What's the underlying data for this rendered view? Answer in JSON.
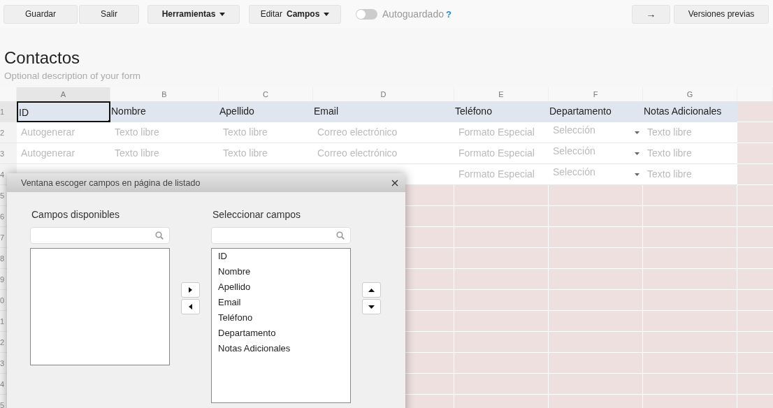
{
  "toolbar": {
    "buttons": [
      {
        "label": "Guardar",
        "kind": "plain"
      },
      {
        "label": "Salir",
        "kind": "plain"
      },
      {
        "label": "Herramientas",
        "kind": "menu"
      },
      {
        "label": "Editar **Campos**",
        "kind": "menu"
      }
    ],
    "autosave": {
      "label": "Autoguardado",
      "on": false,
      "help": "?"
    },
    "right_buttons": [
      {
        "label": "→"
      },
      {
        "label": "Versiones previas"
      }
    ]
  },
  "form": {
    "title": "Contactos",
    "description": "Optional description of your form"
  },
  "grid": {
    "columns": [
      {
        "label": "A",
        "selected": true
      },
      {
        "label": "B",
        "selected": false
      },
      {
        "label": "C",
        "selected": false
      },
      {
        "label": "D",
        "selected": false
      },
      {
        "label": "E",
        "selected": false
      },
      {
        "label": "F",
        "selected": false
      },
      {
        "label": "G",
        "selected": false
      }
    ],
    "rows": [
      {
        "number": "1",
        "selected": true,
        "kind": "header",
        "cells": [
          {
            "text": "ID",
            "kind": "text"
          },
          {
            "text": "Nombre",
            "kind": "text"
          },
          {
            "text": "Apellido",
            "kind": "text"
          },
          {
            "text": "Email",
            "kind": "text"
          },
          {
            "text": "Teléfono",
            "kind": "text"
          },
          {
            "text": "Departamento",
            "kind": "text"
          },
          {
            "text": "Notas Adicionales",
            "kind": "text"
          }
        ]
      },
      {
        "number": "2",
        "selected": false,
        "kind": "field",
        "cells": [
          {
            "text": "Autogenerar",
            "kind": "text"
          },
          {
            "text": "Texto libre",
            "kind": "text"
          },
          {
            "text": "Texto libre",
            "kind": "text"
          },
          {
            "text": "Correo electrónico",
            "kind": "text"
          },
          {
            "text": "Formato Especial",
            "kind": "text"
          },
          {
            "text": "Selección",
            "kind": "select"
          },
          {
            "text": "Texto libre",
            "kind": "text"
          }
        ]
      },
      {
        "number": "3",
        "selected": false,
        "kind": "field",
        "cells": [
          {
            "text": "Autogenerar",
            "kind": "text"
          },
          {
            "text": "Texto libre",
            "kind": "text"
          },
          {
            "text": "Texto libre",
            "kind": "text"
          },
          {
            "text": "Correo electrónico",
            "kind": "text"
          },
          {
            "text": "Formato Especial",
            "kind": "text"
          },
          {
            "text": "Selección",
            "kind": "select"
          },
          {
            "text": "Texto libre",
            "kind": "text"
          }
        ]
      },
      {
        "number": "4",
        "selected": false,
        "kind": "field",
        "cells": [
          {
            "kind": "covered"
          },
          {
            "kind": "covered"
          },
          {
            "kind": "covered"
          },
          {
            "kind": "covered"
          },
          {
            "text": "Formato Especial",
            "kind": "text"
          },
          {
            "text": "Selección",
            "kind": "select"
          },
          {
            "text": "Texto libre",
            "kind": "text"
          }
        ]
      },
      {
        "number": "5",
        "selected": false,
        "kind": "empty"
      },
      {
        "number": "6",
        "selected": false,
        "kind": "empty"
      },
      {
        "number": "7",
        "selected": false,
        "kind": "empty"
      },
      {
        "number": "8",
        "selected": false,
        "kind": "empty"
      },
      {
        "number": "9",
        "selected": false,
        "kind": "empty"
      },
      {
        "number": "0",
        "selected": false,
        "kind": "empty"
      },
      {
        "number": "1",
        "selected": false,
        "kind": "empty"
      },
      {
        "number": "2",
        "selected": false,
        "kind": "empty"
      },
      {
        "number": "3",
        "selected": false,
        "kind": "empty"
      },
      {
        "number": "4",
        "selected": false,
        "kind": "empty"
      },
      {
        "number": "5",
        "selected": false,
        "kind": "empty"
      }
    ]
  },
  "dialog": {
    "title": "Ventana escoger campos en página de listado",
    "available": {
      "label": "Campos disponibles"
    },
    "selected_fields": {
      "label": "Seleccionar campos",
      "items": [
        "ID",
        "Nombre",
        "Apellido",
        "Email",
        "Teléfono",
        "Departamento",
        "Notas Adicionales"
      ]
    }
  }
}
